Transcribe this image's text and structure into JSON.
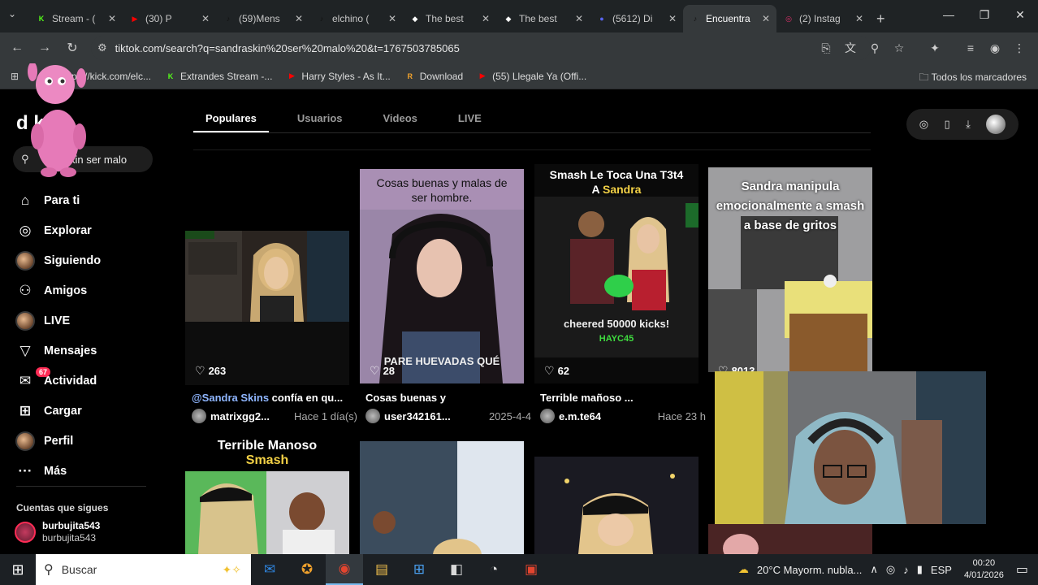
{
  "browser": {
    "tabs": [
      {
        "title": "Stream - (",
        "fav": "K",
        "color": "#53fc18",
        "active": false
      },
      {
        "title": "(30) P",
        "fav": "▶",
        "color": "#ff0000",
        "active": false
      },
      {
        "title": "(59)Mens",
        "fav": "♪",
        "color": "#111111",
        "active": false
      },
      {
        "title": "elchino (",
        "fav": "♪",
        "color": "#111111",
        "active": false
      },
      {
        "title": "The best",
        "fav": "◆",
        "color": "#ffffff",
        "active": false
      },
      {
        "title": "The best",
        "fav": "◆",
        "color": "#ffffff",
        "active": false
      },
      {
        "title": "(5612) Di",
        "fav": "●",
        "color": "#5865f2",
        "active": false
      },
      {
        "title": "Encuentra",
        "fav": "♪",
        "color": "#111111",
        "active": true
      },
      {
        "title": "(2) Instag",
        "fav": "◎",
        "color": "#e1306c",
        "active": false
      }
    ],
    "new_tab": "+",
    "url": "tiktok.com/search?q=sandraskin%20ser%20malo%20&t=1767503785065",
    "bookmarks": [
      {
        "label": "ps://kick.com/elc...",
        "icon": "",
        "color": "#35393b"
      },
      {
        "label": "Extrandes Stream -...",
        "icon": "K",
        "color": "#53fc18"
      },
      {
        "label": "Harry Styles - As It...",
        "icon": "▶",
        "color": "#ff0000"
      },
      {
        "label": "Download",
        "icon": "R",
        "color": "#f0a12c"
      },
      {
        "label": "(55) Llegale Ya (Offi...",
        "icon": "▶",
        "color": "#ff0000"
      }
    ],
    "all_bookmarks": "Todos los marcadores"
  },
  "tiktok": {
    "logo": "d        k",
    "search_value": "skin ser malo",
    "nav": [
      {
        "label": "Para ti",
        "icon": "⌂"
      },
      {
        "label": "Explorar",
        "icon": "◎"
      },
      {
        "label": "Siguiendo",
        "icon": "avatar"
      },
      {
        "label": "Amigos",
        "icon": "⚇"
      },
      {
        "label": "LIVE",
        "icon": "avatar"
      },
      {
        "label": "Mensajes",
        "icon": "▽"
      },
      {
        "label": "Actividad",
        "icon": "✉",
        "badge": "67"
      },
      {
        "label": "Cargar",
        "icon": "⊞"
      },
      {
        "label": "Perfil",
        "icon": "avatar"
      },
      {
        "label": "Más",
        "icon": "···"
      }
    ],
    "following_title": "Cuentas que sigues",
    "following": [
      {
        "name": "burbujita543",
        "handle": "burbujita543"
      }
    ],
    "tabs": [
      "Populares",
      "Usuarios",
      "Videos",
      "LIVE"
    ],
    "cards": [
      {
        "caption": "",
        "likes": "263",
        "desc_tag": "@Sandra Skins",
        "desc": " confía en qu...",
        "user": "matrixgg2...",
        "time": "Hace 1 día(s)"
      },
      {
        "caption": "Cosas buenas y malas de ser hombre.",
        "overlay": "PARE HUEVADAS QUÉ",
        "likes": "28",
        "desc_tag": "",
        "desc": "Cosas buenas y",
        "user": "user342161...",
        "time": "2025-4-4"
      },
      {
        "caption": "Smash Le Toca Una T3t4",
        "caption_b": "A ",
        "caption_hl": "Sandra",
        "overlay": "cheered 50000 kicks!",
        "overlay2": "HAYC45",
        "likes": "62",
        "desc_tag": "",
        "desc": "Terrible mañoso ...",
        "user": "e.m.te64",
        "time": "Hace 23 h"
      },
      {
        "caption": "Sandra manipula emocionalmente a smash a base de gritos",
        "likes": "8013"
      },
      {
        "caption": "Terrible Manoso",
        "caption_hl": "Smash"
      },
      {
        "caption": ""
      },
      {
        "caption": ""
      }
    ]
  },
  "taskbar": {
    "search_placeholder": "Buscar",
    "weather": "20°C  Mayorm. nubla...",
    "lang": "ESP",
    "time": "00:20",
    "date": "4/01/2026"
  }
}
